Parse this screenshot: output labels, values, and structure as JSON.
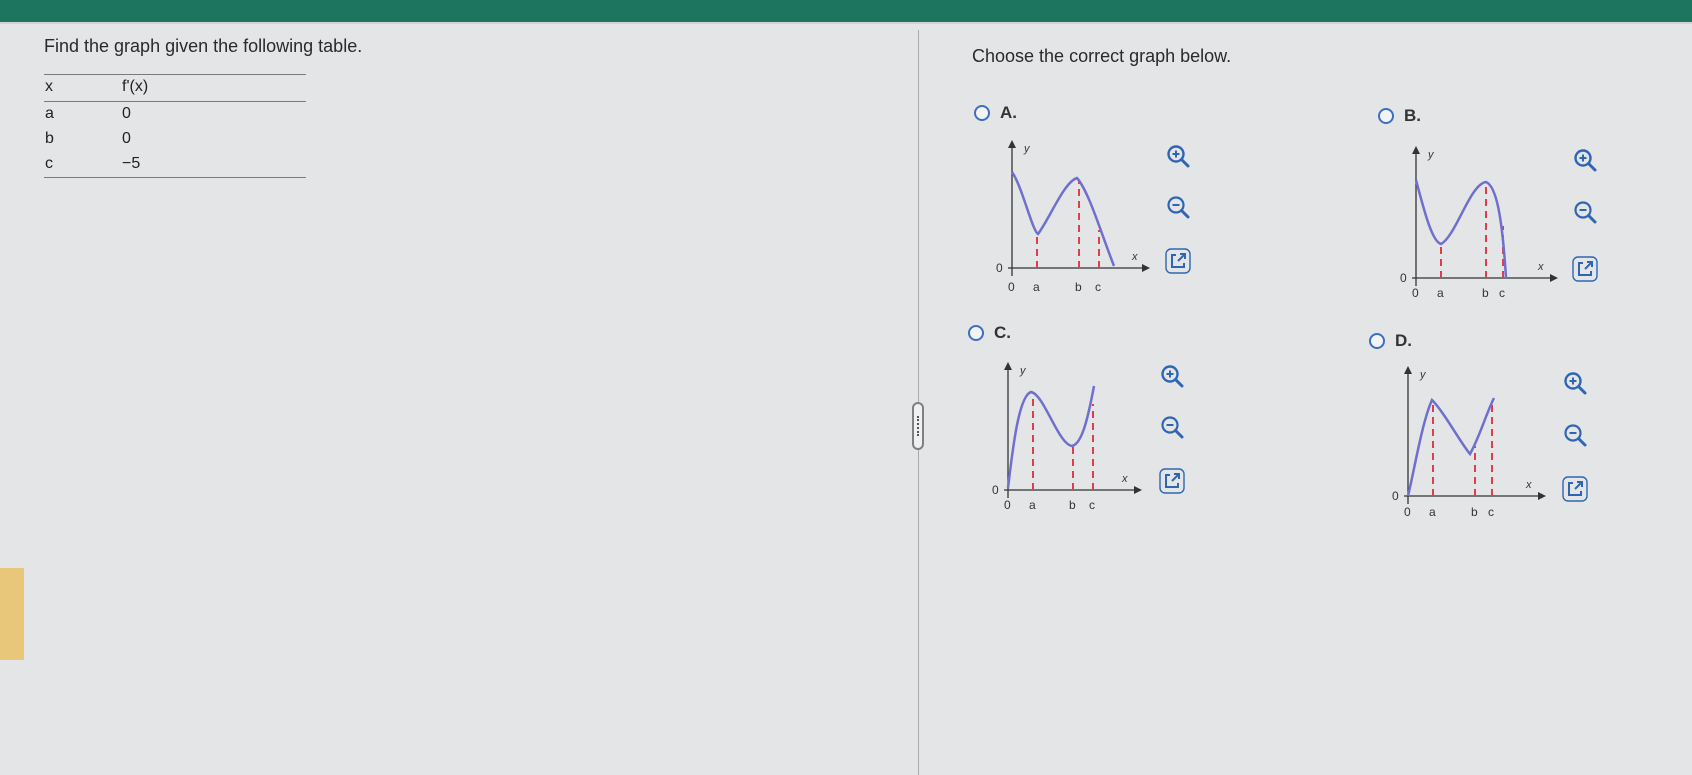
{
  "question": {
    "text": "Find the graph given the following table.",
    "table": {
      "headers": [
        "x",
        "f'(x)"
      ],
      "rows": [
        {
          "x": "a",
          "fpx": "0"
        },
        {
          "x": "b",
          "fpx": "0"
        },
        {
          "x": "c",
          "fpx": "−5"
        }
      ]
    }
  },
  "answer_prompt": "Choose the correct graph below.",
  "options": [
    {
      "letter": "A.",
      "graph": {
        "axis_y": "y",
        "axis_x": "x",
        "origin": "0",
        "zero_tick": "0",
        "tick_a": "a",
        "tick_b": "b",
        "tick_c": "c"
      }
    },
    {
      "letter": "B.",
      "graph": {
        "axis_y": "y",
        "axis_x": "x",
        "origin": "0",
        "zero_tick": "0",
        "tick_a": "a",
        "tick_b": "b",
        "tick_c": "c"
      }
    },
    {
      "letter": "C.",
      "graph": {
        "axis_y": "y",
        "axis_x": "x",
        "origin": "0",
        "zero_tick": "0",
        "tick_a": "a",
        "tick_b": "b",
        "tick_c": "c"
      }
    },
    {
      "letter": "D.",
      "graph": {
        "axis_y": "y",
        "axis_x": "x",
        "origin": "0",
        "zero_tick": "0",
        "tick_a": "a",
        "tick_b": "b",
        "tick_c": "c"
      }
    }
  ],
  "tools": [
    "zoom-in-icon",
    "zoom-out-icon",
    "open-external-icon"
  ],
  "colors": {
    "curve": "#6f6fcf",
    "guide": "#e23b4a",
    "tool_icon": "#2f66b3",
    "header_bar": "#1d7560"
  }
}
